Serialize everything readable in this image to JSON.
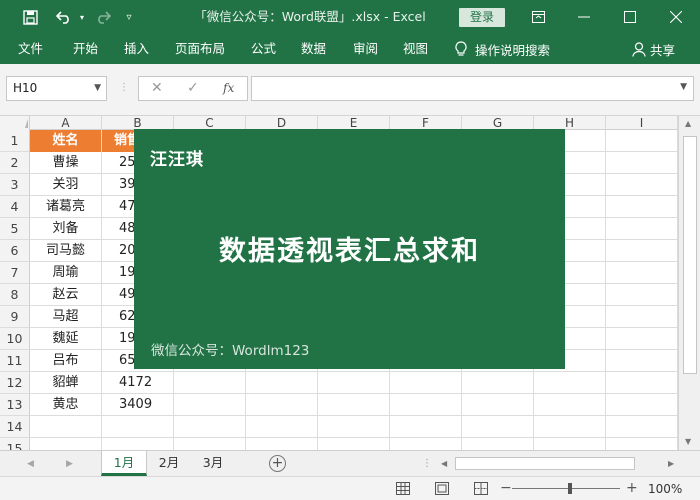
{
  "titlebar": {
    "save_icon": "save-icon",
    "undo_icon": "undo-icon",
    "redo_icon": "redo-icon",
    "customize_icon": "customize-quick-access-icon",
    "title": "「微信公众号：Word联盟」.xlsx  -  Excel",
    "login": "登录",
    "ribbon_display_icon": "ribbon-display-options-icon",
    "minimize_icon": "minimize-icon",
    "maximize_icon": "maximize-icon",
    "close_icon": "close-icon"
  },
  "menu": {
    "items": [
      "文件",
      "开始",
      "插入",
      "页面布局",
      "公式",
      "数据",
      "审阅",
      "视图"
    ],
    "search_label": "操作说明搜索",
    "share_label": "共享"
  },
  "formula_bar": {
    "name_box": "H10",
    "fx_label": "fx",
    "formula_value": ""
  },
  "grid": {
    "columns": [
      "A",
      "B",
      "C",
      "D",
      "E",
      "F",
      "G",
      "H",
      "I"
    ],
    "rows": [
      "1",
      "2",
      "3",
      "4",
      "5",
      "6",
      "7",
      "8",
      "9",
      "10",
      "11",
      "12",
      "13",
      "14",
      "15"
    ],
    "header": [
      "姓名",
      "销售"
    ],
    "data": [
      [
        "曹操",
        "25"
      ],
      [
        "关羽",
        "39"
      ],
      [
        "诸葛亮",
        "47"
      ],
      [
        "刘备",
        "48"
      ],
      [
        "司马懿",
        "20"
      ],
      [
        "周瑜",
        "19"
      ],
      [
        "赵云",
        "49"
      ],
      [
        "马超",
        "62"
      ],
      [
        "魏延",
        "19"
      ],
      [
        "吕布",
        "65"
      ],
      [
        "貂蝉",
        "4172"
      ],
      [
        "黄忠",
        "3409"
      ]
    ]
  },
  "overlay": {
    "author": "汪汪琪",
    "headline": "数据透视表汇总求和",
    "footer": "微信公众号：Wordlm123"
  },
  "sheets": {
    "tabs": [
      "1月",
      "2月",
      "3月"
    ],
    "active": "1月"
  },
  "status": {
    "zoom": "100%",
    "zoom_minus": "−",
    "zoom_plus": "+"
  },
  "colors": {
    "brand": "#217346",
    "header_fill": "#ed7d31"
  }
}
